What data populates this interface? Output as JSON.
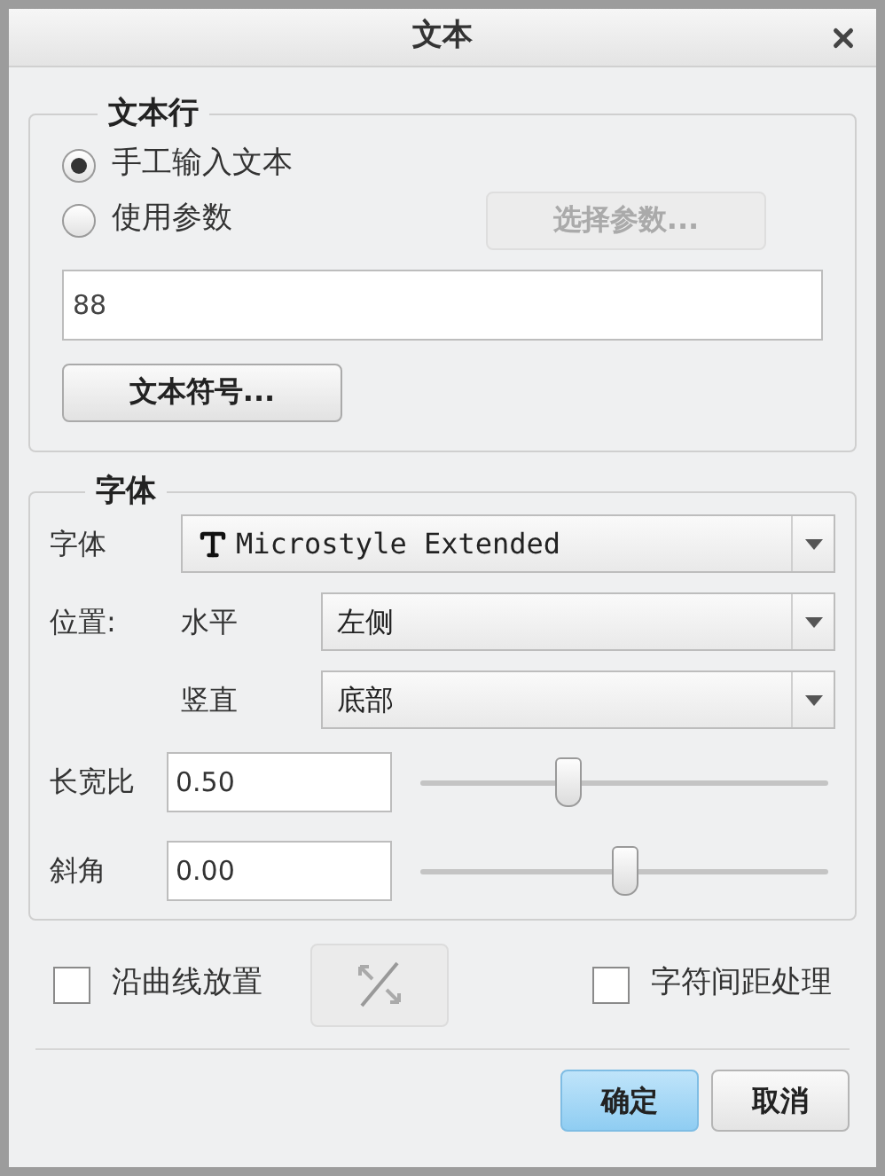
{
  "window": {
    "title": "文本"
  },
  "text_line": {
    "legend": "文本行",
    "options": [
      {
        "label": "手工输入文本",
        "selected": true
      },
      {
        "label": "使用参数",
        "selected": false
      }
    ],
    "select_param_button": {
      "label": "选择参数...",
      "disabled": true
    },
    "text_value": "88",
    "symbol_button": {
      "label": "文本符号..."
    }
  },
  "font_group": {
    "legend": "字体",
    "font": {
      "label": "字体",
      "value": "Microstyle Extended"
    },
    "position_label": "位置:",
    "horizontal": {
      "label": "水平",
      "value": "左侧"
    },
    "vertical": {
      "label": "竖直",
      "value": "底部"
    },
    "sliders": [
      {
        "label": "长宽比",
        "value": "0.50",
        "level": 0.36
      },
      {
        "label": "斜角",
        "value": "0.00",
        "level": 0.5
      }
    ]
  },
  "checkboxes": [
    {
      "label": "沿曲线放置",
      "checked": false
    },
    {
      "label": "字符间距处理",
      "checked": false
    }
  ],
  "flip_button": {
    "disabled": true
  },
  "buttons": [
    {
      "label": "确定",
      "selected": true
    },
    {
      "label": "取消",
      "selected": false
    }
  ]
}
